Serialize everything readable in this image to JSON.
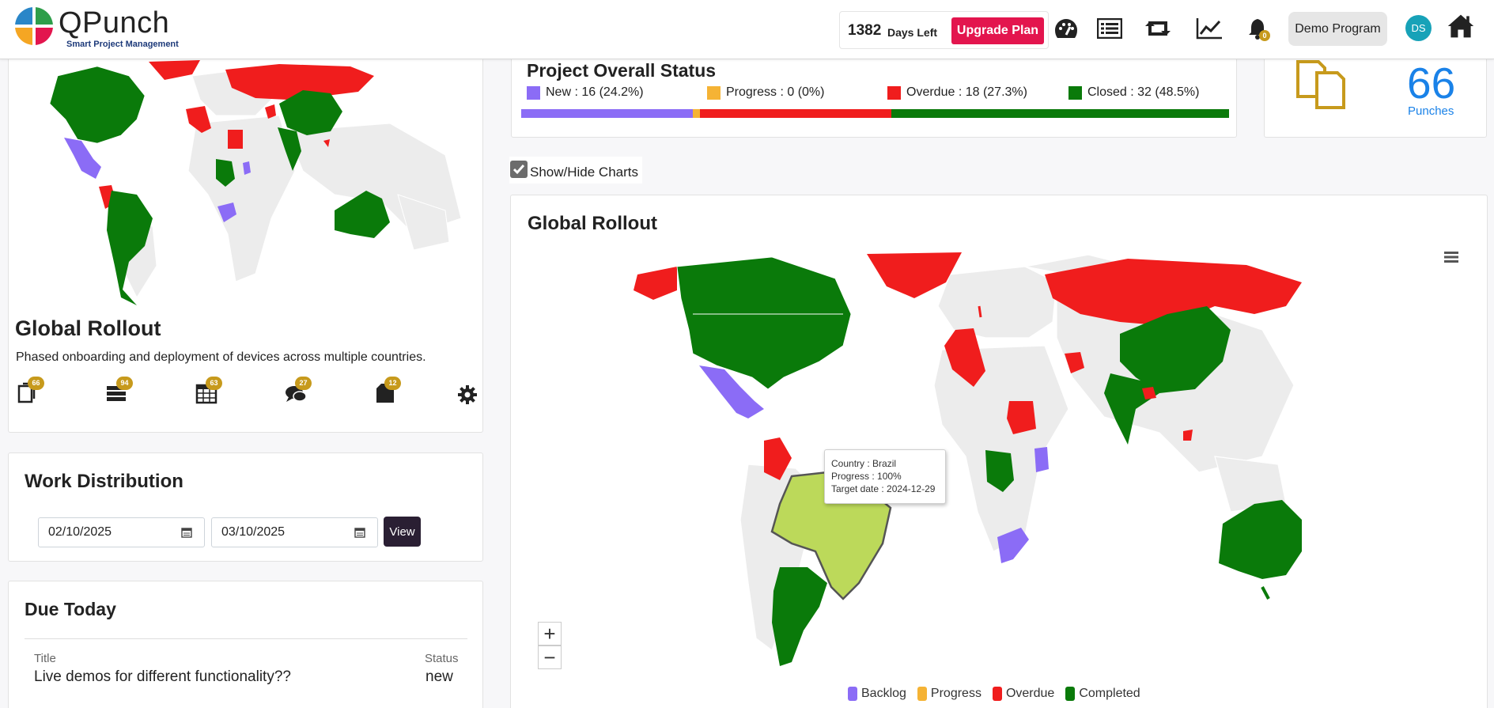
{
  "brand": {
    "name": "QPunch",
    "tagline": "Smart Project Management"
  },
  "header": {
    "days_left_number": "1382",
    "days_left_label": "Days Left",
    "upgrade_label": "Upgrade Plan",
    "notification_count": "0",
    "program_label": "Demo Program",
    "avatar_initials": "DS"
  },
  "project": {
    "title": "Global Rollout",
    "description": "Phased onboarding and deployment of devices across multiple countries.",
    "counts": {
      "documents": "66",
      "tasks": "94",
      "calendar": "63",
      "comments": "27",
      "notes": "12"
    }
  },
  "work_distribution": {
    "title": "Work Distribution",
    "from_date": "02/10/2025",
    "to_date": "03/10/2025",
    "view_label": "View"
  },
  "due_today": {
    "title": "Due Today",
    "col_title": "Title",
    "col_status": "Status",
    "rows": [
      {
        "title": "Live demos for different functionality??",
        "status": "new"
      }
    ]
  },
  "overall_status": {
    "title": "Project Overall Status",
    "items": [
      {
        "label": "New : 16 (24.2%)",
        "color": "#8b6cf6"
      },
      {
        "label": "Progress : 0 (0%)",
        "color": "#f5b335"
      },
      {
        "label": "Overdue : 18 (27.3%)",
        "color": "#f01d1d"
      },
      {
        "label": "Closed : 32 (48.5%)",
        "color": "#0a7a0a"
      }
    ],
    "segments": [
      {
        "fraction": 0.242,
        "color": "#8b6cf6"
      },
      {
        "fraction": 0.011,
        "color": "#f5b335"
      },
      {
        "fraction": 0.27,
        "color": "#f01d1d"
      },
      {
        "fraction": 0.477,
        "color": "#0a7a0a"
      }
    ]
  },
  "punches": {
    "count": "66",
    "label": "Punches"
  },
  "charts_toggle": {
    "label": "Show/Hide Charts",
    "checked": true
  },
  "map": {
    "title": "Global Rollout",
    "tooltip": {
      "country": "Country : Brazil",
      "progress": "Progress : 100%",
      "target": "Target date : 2024-12-29"
    },
    "zoom_in": "+",
    "zoom_out": "−",
    "legend": [
      {
        "label": "Backlog",
        "color": "#8b6cf6"
      },
      {
        "label": "Progress",
        "color": "#f5b335"
      },
      {
        "label": "Overdue",
        "color": "#f01d1d"
      },
      {
        "label": "Completed",
        "color": "#0a7a0a"
      }
    ],
    "highlight_color": "#bcd95a"
  }
}
